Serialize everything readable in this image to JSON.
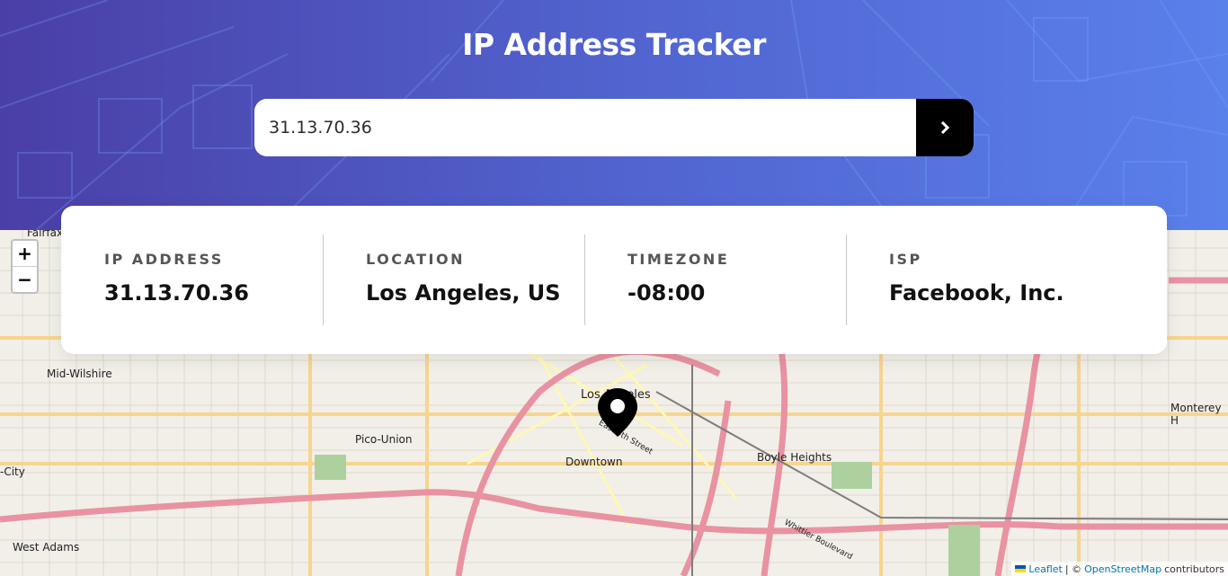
{
  "header": {
    "title": "IP Address Tracker"
  },
  "search": {
    "value": "31.13.70.36",
    "submit_icon": "chevron-right-icon"
  },
  "stats": [
    {
      "label": "IP ADDRESS",
      "value": "31.13.70.36"
    },
    {
      "label": "LOCATION",
      "value": "Los Angeles, US"
    },
    {
      "label": "TIMEZONE",
      "value": "-08:00"
    },
    {
      "label": "ISP",
      "value": "Facebook, Inc."
    }
  ],
  "map": {
    "zoom_in": "+",
    "zoom_out": "−",
    "places": [
      "Fairfax",
      "Mid-Wilshire",
      "Pico-Union",
      "Downtown",
      "Boyle Heights",
      "Monterey H",
      "-City",
      "West Adams",
      "Los Angeles",
      "East 4th Street",
      "Whittier Boulevard"
    ],
    "marker_icon": "location-pin-icon"
  },
  "attribution": {
    "leaflet": "Leaflet",
    "separator": "| ©",
    "osm": "OpenStreetMap",
    "suffix": "contributors"
  },
  "colors": {
    "accent": "#000000",
    "gradient_start": "#4a3fa6",
    "gradient_end": "#5a80ea"
  }
}
